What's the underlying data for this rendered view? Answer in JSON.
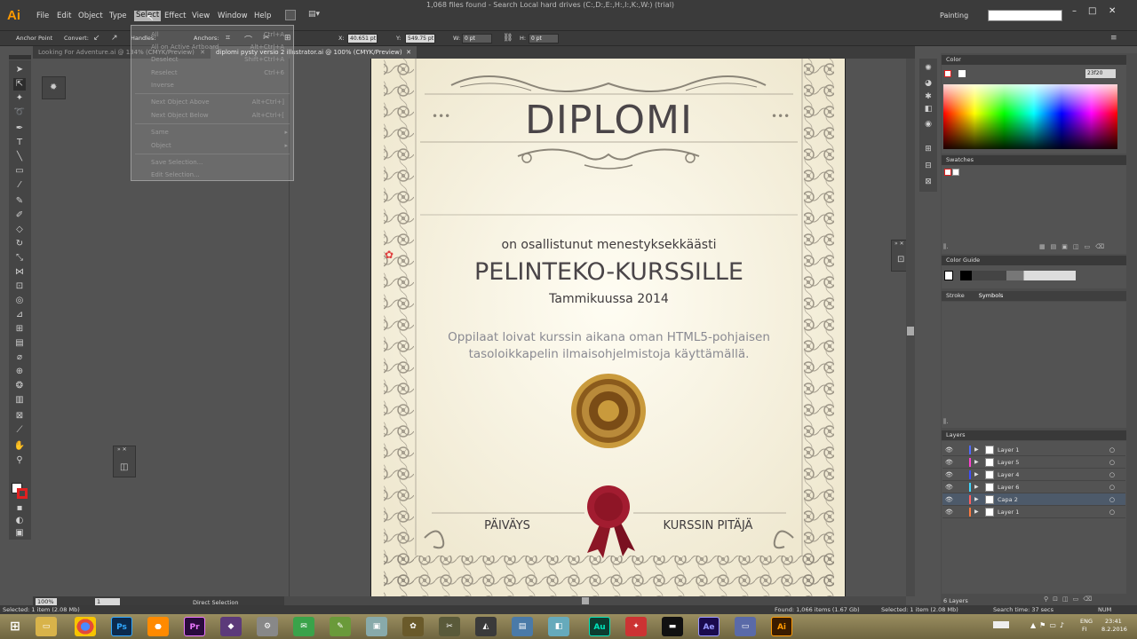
{
  "window": {
    "title": "1,068 files found - Search Local hard drives (C:,D:,E:,H:,I:,K:,W:) (trial)",
    "workspace": "Painting",
    "controls": [
      "–",
      "□",
      "✕"
    ]
  },
  "menu": [
    "File",
    "Edit",
    "Object",
    "Type",
    "Select",
    "Effect",
    "View",
    "Window",
    "Help"
  ],
  "menu_active": "Select",
  "select_menu": {
    "items": [
      {
        "label": "All",
        "shortcut": "Ctrl+A"
      },
      {
        "label": "All on Active Artboard",
        "shortcut": "Alt+Ctrl+A"
      },
      {
        "label": "Deselect",
        "shortcut": "Shift+Ctrl+A"
      },
      {
        "label": "Reselect",
        "shortcut": "Ctrl+6"
      },
      {
        "label": "Inverse",
        "shortcut": ""
      },
      {
        "label": "Next Object Above",
        "shortcut": "Alt+Ctrl+]"
      },
      {
        "label": "Next Object Below",
        "shortcut": "Alt+Ctrl+["
      },
      {
        "label": "Same",
        "shortcut": "▸"
      },
      {
        "label": "Object",
        "shortcut": "▸"
      },
      {
        "label": "Save Selection...",
        "shortcut": ""
      },
      {
        "label": "Edit Selection...",
        "shortcut": ""
      }
    ]
  },
  "control_bar": {
    "anchor_point": "Anchor Point",
    "convert": "Convert:",
    "handles": "Handles:",
    "anchors": "Anchors:",
    "x_label": "X:",
    "x_value": "40.651 pt",
    "y_label": "Y:",
    "y_value": "549.75 pt",
    "w_label": "W:",
    "w_value": "0 pt",
    "h_label": "H:",
    "h_value": "0 pt"
  },
  "tabs": [
    {
      "label": "Looking For Adventure.ai @ 134% (CMYK/Preview)",
      "close": "✕"
    },
    {
      "label": "diplomi pysty versio 2 illustrator.ai @ 100% (CMYK/Preview)",
      "close": "✕"
    }
  ],
  "diploma": {
    "title": "DIPLOMI",
    "line1": "on osallistunut menestyksekkäästi",
    "course": "PELINTEKO-KURSSILLE",
    "date": "Tammikuussa 2014",
    "desc1": "Oppilaat loivat kurssin aikana oman HTML5-pohjaisen",
    "desc2": "tasoloikkapelin ilmaisohjelmistoja käyttämällä.",
    "date_label": "PÄIVÄYS",
    "leader_label": "KURSSIN PITÄJÄ"
  },
  "panels": {
    "color": "Color",
    "color_hex": "23f20",
    "swatches": "Swatches",
    "color_guide": "Color Guide",
    "stroke": "Stroke",
    "symbols": "Symbols",
    "layers": "Layers",
    "layers_count": "6 Layers"
  },
  "layers": [
    {
      "name": "Layer 1",
      "color": "#4f6bff",
      "selected": false
    },
    {
      "name": "Layer 5",
      "color": "#ff3fd0",
      "selected": false
    },
    {
      "name": "Layer 4",
      "color": "#3f4fff",
      "selected": false
    },
    {
      "name": "Layer 6",
      "color": "#3fd6ff",
      "selected": false
    },
    {
      "name": "Capa 2",
      "color": "#ff5f5f",
      "selected": true
    },
    {
      "name": "Layer 1",
      "color": "#ff7a3f",
      "selected": false
    }
  ],
  "status": {
    "zoom": "100%",
    "artboard": "1",
    "tool": "Direct Selection",
    "left": "Selected: 1 item (2.08 Mb)",
    "found": "Found: 1,066 items (1.67 Gb)",
    "selected": "Selected: 1 item (2.08 Mb)",
    "search_time": "Search time: 37 secs",
    "num": "NUM"
  },
  "taskbar": {
    "lang": "ENG",
    "region": "FI",
    "time": "23:41",
    "date": "8.2.2016",
    "apps": [
      {
        "name": "Ps",
        "color": "#0c2a4d",
        "text_color": "#31a8ff"
      },
      {
        "name": "Pr",
        "color": "#2a0a3d",
        "text_color": "#ea77ff"
      },
      {
        "name": "Au",
        "color": "#0c3d30",
        "text_color": "#00e4bb"
      },
      {
        "name": "Ae",
        "color": "#1a0a4d",
        "text_color": "#9999ff"
      },
      {
        "name": "Ai",
        "color": "#3a1c00",
        "text_color": "#ff9a00"
      }
    ]
  },
  "colors": {
    "artboard": "#f6f2e2",
    "ornament": "#8b8578",
    "title": "#4a4548",
    "gold": "#a06a1a",
    "seal": "#9c1a2c",
    "description": "#8a8a92"
  }
}
